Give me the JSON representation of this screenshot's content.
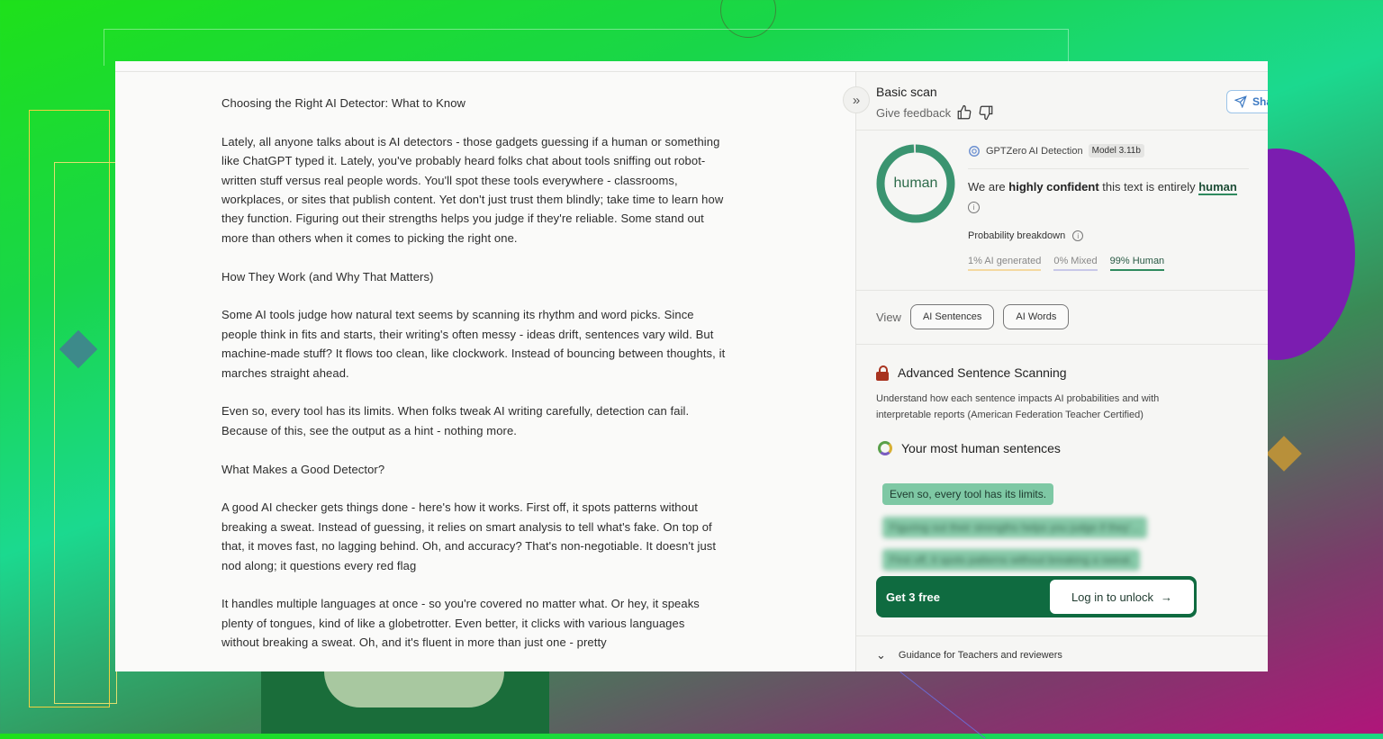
{
  "document": {
    "paragraphs": [
      "Choosing the Right AI Detector: What to Know",
      "Lately, all anyone talks about is AI detectors - those gadgets guessing if a human or something like ChatGPT typed it. Lately, you've probably heard folks chat about tools sniffing out robot-written stuff versus real people words. You'll spot these tools everywhere - classrooms, workplaces, or sites that publish content. Yet don't just trust them blindly; take time to learn how they function. Figuring out their strengths helps you judge if they're reliable. Some stand out more than others when it comes to picking the right one.",
      "How They Work (and Why That Matters)",
      "Some AI tools judge how natural text seems by scanning its rhythm and word picks. Since people think in fits and starts, their writing's often messy - ideas drift, sentences vary wild. But machine-made stuff? It flows too clean, like clockwork. Instead of bouncing between thoughts, it marches straight ahead.",
      "Even so, every tool has its limits. When folks tweak AI writing carefully, detection can fail. Because of this, see the output as a hint - nothing more.",
      "What Makes a Good Detector?",
      "A good AI checker gets things done - here's how it works. First off, it spots patterns without breaking a sweat. Instead of guessing, it relies on smart analysis to tell what's fake. On top of that, it moves fast, no lagging behind. Oh, and accuracy? That's non-negotiable. It doesn't just nod along; it questions every red flag",
      "It handles multiple languages at once - so you're covered no matter what. Or hey, it speaks plenty of tongues, kind of like a globetrotter. Even better, it clicks with various languages without breaking a sweat. Oh, and it's fluent in more than just one - pretty"
    ]
  },
  "panel": {
    "title": "Basic scan",
    "feedback_label": "Give feedback",
    "share_label": "Sha",
    "result_label": "human",
    "detector_name": "GPTZero AI Detection",
    "model_badge": "Model 3.11b",
    "confidence_prefix": "We are ",
    "confidence_bold": "highly confident",
    "confidence_middle": " this text is entirely ",
    "confidence_result": "human",
    "probability_title": "Probability breakdown",
    "prob_ai": "1% AI generated",
    "prob_mixed": "0% Mixed",
    "prob_human": "99% Human",
    "human_fraction": 0.99,
    "view_label": "View",
    "view_ai_sentences": "AI Sentences",
    "view_ai_words": "AI Words",
    "advanced_title": "Advanced Sentence Scanning",
    "advanced_desc": "Understand how each sentence impacts AI probabilities and with interpretable reports (American Federation Teacher Certified)",
    "human_sentences_title": "Your most human sentences",
    "sentence_1": "Even so, every tool has its limits.",
    "sentence_2": "Figuring out their strengths helps you judge if they'...",
    "sentence_3": "First off, it spots patterns without breaking a sweat.",
    "get_free": "Get 3 free",
    "login_unlock": "Log in to unlock",
    "guidance": "Guidance for Teachers and reviewers"
  },
  "colors": {
    "accent_green": "#2f8a5e",
    "dark_green": "#0f6b40",
    "lock_red": "#a8331f"
  }
}
